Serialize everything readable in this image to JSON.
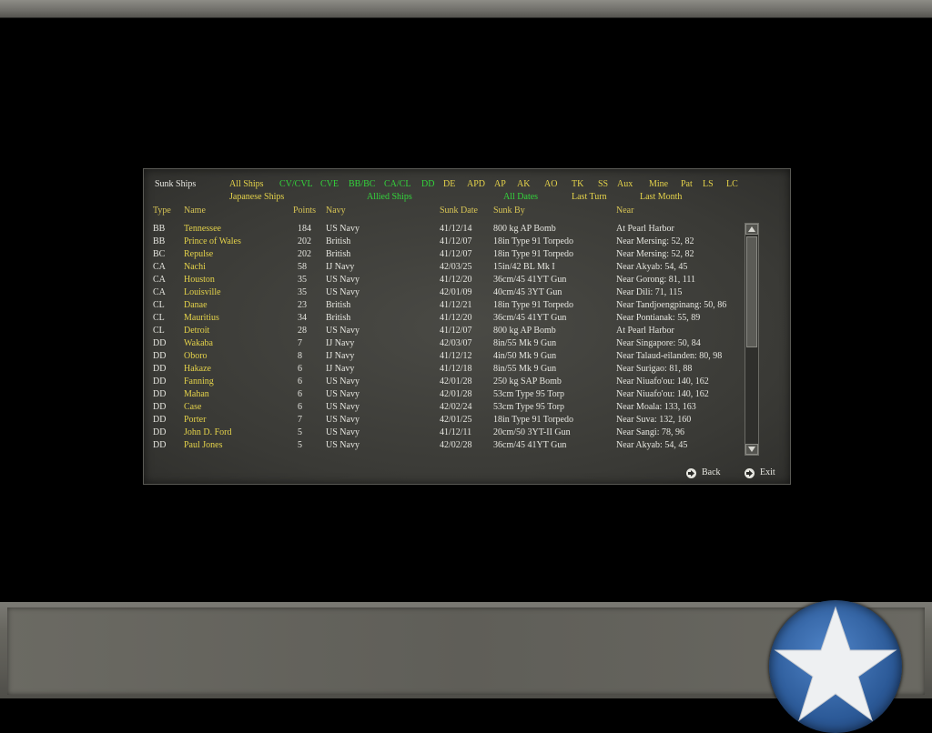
{
  "panel": {
    "title": "Sunk Ships",
    "filters_row1": [
      "All Ships",
      "CV/CVL",
      "CVE",
      "BB/BC",
      "CA/CL",
      "DD",
      "DE",
      "APD",
      "AP",
      "AK",
      "AO",
      "TK",
      "SS",
      "Aux",
      "Mine",
      "Pat",
      "LS",
      "LC"
    ],
    "filters_row2": [
      "Japanese Ships",
      "Allied Ships",
      "All Dates",
      "Last Turn",
      "Last Month"
    ],
    "columns": {
      "type": "Type",
      "name": "Name",
      "points": "Points",
      "navy": "Navy",
      "date": "Sunk Date",
      "by": "Sunk By",
      "near": "Near"
    },
    "rows": [
      {
        "type": "BB",
        "name": "Tennessee",
        "points": "184",
        "navy": "US Navy",
        "date": "41/12/14",
        "by": "800 kg AP Bomb",
        "near": "At Pearl Harbor"
      },
      {
        "type": "BB",
        "name": "Prince of Wales",
        "points": "202",
        "navy": "British",
        "date": "41/12/07",
        "by": "18in Type 91 Torpedo",
        "near": "Near Mersing: 52, 82"
      },
      {
        "type": "BC",
        "name": "Repulse",
        "points": "202",
        "navy": "British",
        "date": "41/12/07",
        "by": "18in Type 91 Torpedo",
        "near": "Near Mersing: 52, 82"
      },
      {
        "type": "CA",
        "name": "Nachi",
        "points": "58",
        "navy": "IJ Navy",
        "date": "42/03/25",
        "by": "15in/42 BL Mk I",
        "near": "Near Akyab: 54, 45"
      },
      {
        "type": "CA",
        "name": "Houston",
        "points": "35",
        "navy": "US Navy",
        "date": "41/12/20",
        "by": "36cm/45 41YT Gun",
        "near": "Near Gorong: 81, 111"
      },
      {
        "type": "CA",
        "name": "Louisville",
        "points": "35",
        "navy": "US Navy",
        "date": "42/01/09",
        "by": "40cm/45 3YT Gun",
        "near": "Near Dili: 71, 115"
      },
      {
        "type": "CL",
        "name": "Danae",
        "points": "23",
        "navy": "British",
        "date": "41/12/21",
        "by": "18in Type 91 Torpedo",
        "near": "Near Tandjoengpinang: 50, 86"
      },
      {
        "type": "CL",
        "name": "Mauritius",
        "points": "34",
        "navy": "British",
        "date": "41/12/20",
        "by": "36cm/45 41YT Gun",
        "near": "Near Pontianak: 55, 89"
      },
      {
        "type": "CL",
        "name": "Detroit",
        "points": "28",
        "navy": "US Navy",
        "date": "41/12/07",
        "by": "800 kg AP Bomb",
        "near": "At Pearl Harbor"
      },
      {
        "type": "DD",
        "name": "Wakaba",
        "points": "7",
        "navy": "IJ Navy",
        "date": "42/03/07",
        "by": "8in/55 Mk 9 Gun",
        "near": "Near Singapore: 50, 84"
      },
      {
        "type": "DD",
        "name": "Oboro",
        "points": "8",
        "navy": "IJ Navy",
        "date": "41/12/12",
        "by": "4in/50 Mk 9 Gun",
        "near": "Near Talaud-eilanden: 80, 98"
      },
      {
        "type": "DD",
        "name": "Hakaze",
        "points": "6",
        "navy": "IJ Navy",
        "date": "41/12/18",
        "by": "8in/55 Mk 9 Gun",
        "near": "Near Surigao: 81, 88"
      },
      {
        "type": "DD",
        "name": "Fanning",
        "points": "6",
        "navy": "US Navy",
        "date": "42/01/28",
        "by": "250 kg SAP Bomb",
        "near": "Near Niuafo'ou: 140, 162"
      },
      {
        "type": "DD",
        "name": "Mahan",
        "points": "6",
        "navy": "US Navy",
        "date": "42/01/28",
        "by": "53cm Type 95 Torp",
        "near": "Near Niuafo'ou: 140, 162"
      },
      {
        "type": "DD",
        "name": "Case",
        "points": "6",
        "navy": "US Navy",
        "date": "42/02/24",
        "by": "53cm Type 95 Torp",
        "near": "Near Moala: 133, 163"
      },
      {
        "type": "DD",
        "name": "Porter",
        "points": "7",
        "navy": "US Navy",
        "date": "42/01/25",
        "by": "18in Type 91 Torpedo",
        "near": "Near Suva: 132, 160"
      },
      {
        "type": "DD",
        "name": "John D. Ford",
        "points": "5",
        "navy": "US Navy",
        "date": "41/12/11",
        "by": "20cm/50 3YT-II Gun",
        "near": "Near Sangi: 78, 96"
      },
      {
        "type": "DD",
        "name": "Paul Jones",
        "points": "5",
        "navy": "US Navy",
        "date": "42/02/28",
        "by": "36cm/45 41YT Gun",
        "near": "Near Akyab: 54, 45"
      }
    ],
    "back_label": "Back",
    "exit_label": "Exit"
  },
  "colors": {
    "filter_yellow": "#e4d24a",
    "filter_green": "#33d43b",
    "text": "#e6e6e0"
  }
}
